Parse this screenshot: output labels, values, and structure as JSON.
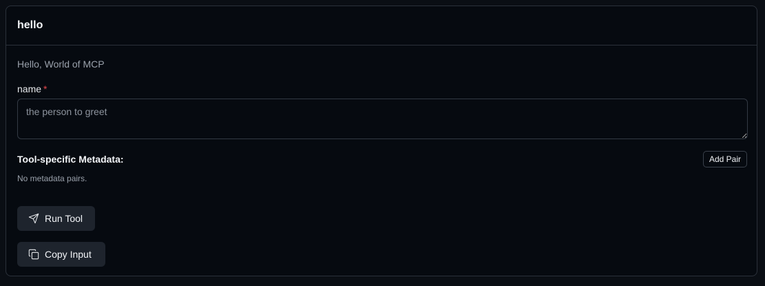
{
  "tool": {
    "title": "hello",
    "description": "Hello, World of MCP"
  },
  "form": {
    "name_label": "name",
    "required_mark": "*",
    "name_placeholder": "the person to greet",
    "name_value": ""
  },
  "metadata": {
    "label": "Tool-specific Metadata:",
    "add_pair_label": "Add Pair",
    "empty_text": "No metadata pairs."
  },
  "actions": {
    "run_label": "Run Tool",
    "run_icon": "send-icon",
    "copy_label": "Copy Input",
    "copy_icon": "copy-icon"
  },
  "colors": {
    "background": "#0a0e14",
    "card_border": "#2b313a",
    "required": "#e5484d",
    "button_bg": "#1e242d"
  }
}
